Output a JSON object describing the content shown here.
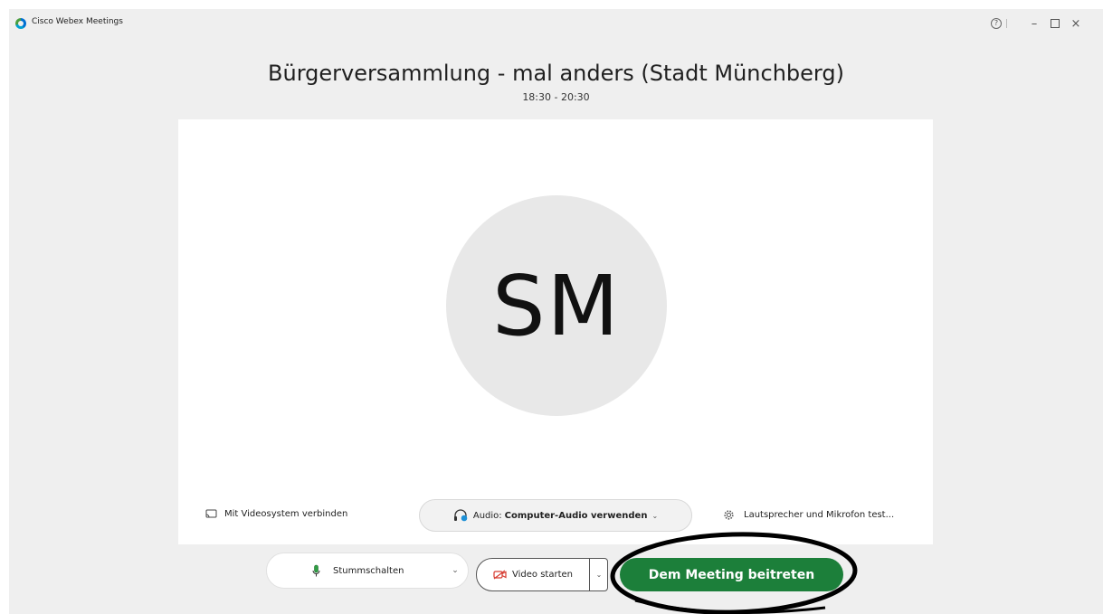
{
  "app": {
    "title": "Cisco Webex Meetings",
    "help_glyph": "?",
    "minimize_glyph": "–",
    "close_glyph": "×"
  },
  "meeting": {
    "title": "Bürgerversammlung - mal anders (Stadt Münchberg)",
    "time": "18:30 - 20:30"
  },
  "preview": {
    "avatar_initials": "SM",
    "avatar_bg": "#e8e8e8"
  },
  "options": {
    "video_system_label": "Mit Videosystem verbinden",
    "audio_prefix": "Audio:",
    "audio_value": "Computer-Audio verwenden",
    "audio_caret": "⌄",
    "speaker_test_label": "Lautsprecher und Mikrofon test..."
  },
  "controls": {
    "mute_label": "Stummschalten",
    "mute_caret": "⌄",
    "video_label": "Video starten",
    "video_caret": "⌄",
    "join_label": "Dem Meeting beitreten",
    "join_color": "#1c7f3a"
  },
  "icons": {
    "logo": "webex-logo-icon",
    "help": "help-icon",
    "minimize": "minimize-icon",
    "maximize": "maximize-icon",
    "close": "close-icon",
    "cast": "cast-icon",
    "headset": "headset-icon",
    "gear": "gear-icon",
    "mic": "microphone-icon",
    "camera_off": "camera-off-icon"
  }
}
